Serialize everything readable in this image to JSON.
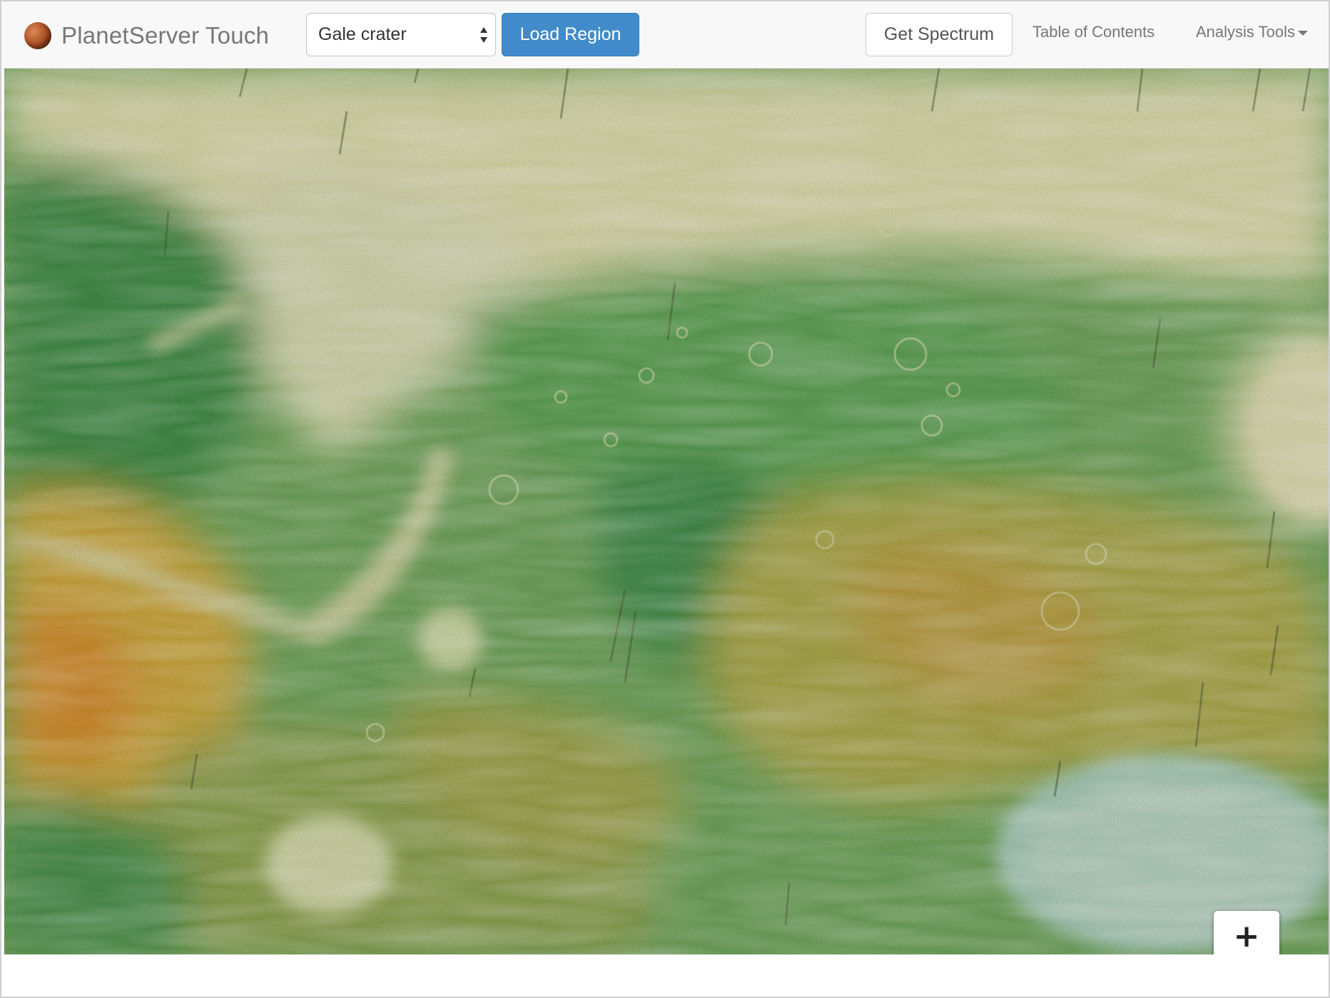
{
  "app": {
    "title": "PlanetServer Touch",
    "logo_icon": "planet-mars-icon"
  },
  "toolbar": {
    "region_select": {
      "value": "Gale crater"
    },
    "load_region_label": "Load Region",
    "get_spectrum_label": "Get Spectrum",
    "table_of_contents_label": "Table of Contents",
    "analysis_tools_label": "Analysis Tools"
  },
  "map": {
    "zoom_in_label": "+",
    "zoom_out_label": "−"
  },
  "colors": {
    "primary_button": "#428bca",
    "navbar_background": "#f8f8f8",
    "navbar_text": "#777777"
  }
}
